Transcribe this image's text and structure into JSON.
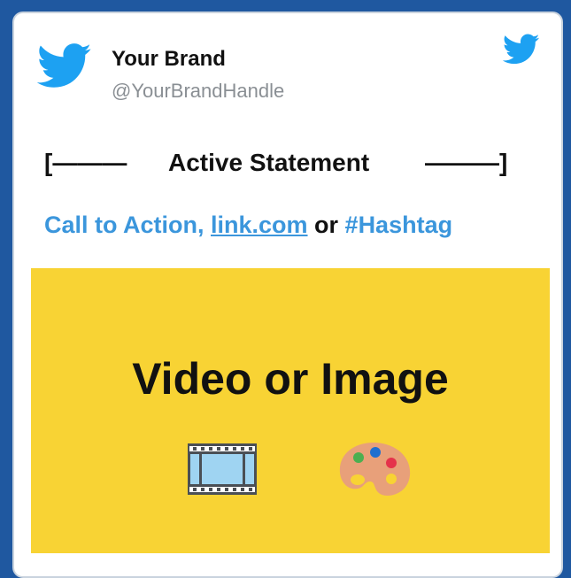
{
  "brand": {
    "name": "Your Brand",
    "handle": "@YourBrandHandle"
  },
  "statement": {
    "left": "[———",
    "text": "Active Statement",
    "right": "———]"
  },
  "cta": {
    "text": "Call to Action, ",
    "link": "link.com",
    "or": " or ",
    "hashtag": "#Hashtag"
  },
  "media": {
    "title": "Video or Image",
    "icons": [
      "film-frames-icon",
      "artist-palette-icon"
    ]
  },
  "colors": {
    "background": "#1f58a0",
    "card": "#ffffff",
    "twitter_blue": "#1da1f2",
    "link_blue": "#3b96dc",
    "media_yellow": "#f8d334"
  }
}
